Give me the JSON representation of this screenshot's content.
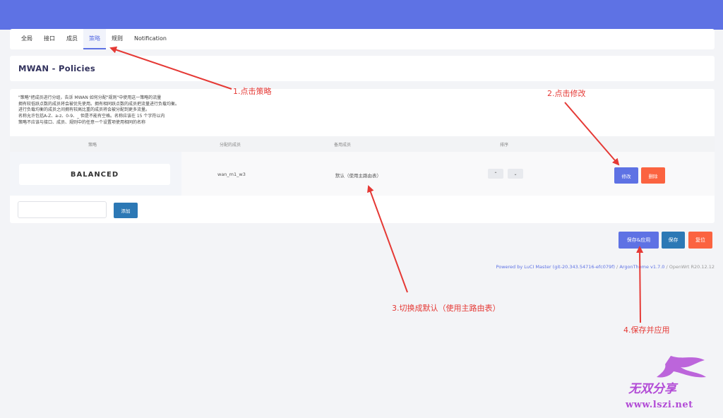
{
  "tabs": [
    {
      "label": "全局",
      "active": false
    },
    {
      "label": "接口",
      "active": false
    },
    {
      "label": "成员",
      "active": false
    },
    {
      "label": "策略",
      "active": true
    },
    {
      "label": "规则",
      "active": false
    },
    {
      "label": "Notification",
      "active": false
    }
  ],
  "page": {
    "title": "MWAN - Policies"
  },
  "description": [
    "\"策略\"把成员进行分组，告诉 MWAN 如何分配\"规则\"中使用这一策略的流量",
    "拥有较低跃点数的成员将会被优先使用。拥有相同跃点数的成员把流量进行负载均衡。",
    "进行负载均衡的成员之间拥有较高比重的成员将会被分配到更多流量。",
    "名称允许包括A-Z、a-z、0-9、_ 但是不能有空格。名称应该在 15 个字符以内",
    "策略不应该与接口、成员、规则中的任意一个设置项使用相同的名称"
  ],
  "table": {
    "headers": [
      "策略",
      "分配的成员",
      "备用成员",
      "排序"
    ],
    "rows": [
      {
        "name": "BALANCED",
        "members": "wan_m1_w3",
        "fallback": "默认（使用主路由表）"
      }
    ]
  },
  "buttons": {
    "edit": "修改",
    "delete": "删除",
    "add": "添加",
    "save_apply": "保存&应用",
    "save": "保存",
    "reset": "复位",
    "up": "⌃",
    "down": "⌄"
  },
  "footer": {
    "luci": "Powered by LuCI Master (git-20.343.54716-efc079f)",
    "sep": " / ",
    "theme": "ArgonTheme v1.7.0",
    "openwrt": "OpenWrt R20.12.12"
  },
  "annotations": {
    "step1": "1.点击策略",
    "step2": "2.点击修改",
    "step3": "3.切换成默认（使用主路由表）",
    "step4": "4.保存并应用"
  },
  "watermark": {
    "site_name": "无双分享",
    "url": "www.lszi.net"
  },
  "colors": {
    "primary": "#5e72e4",
    "danger": "#fb6340",
    "add": "#2c78b5",
    "annotation": "#e53935",
    "watermark": "#b24bd6"
  }
}
